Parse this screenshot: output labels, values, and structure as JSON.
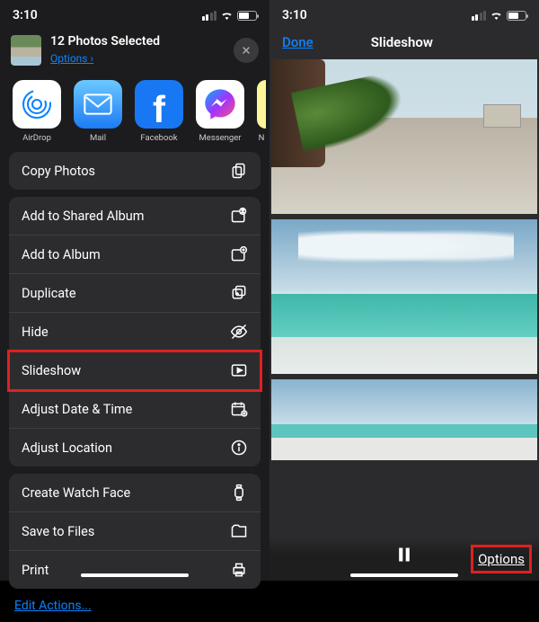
{
  "status": {
    "time": "3:10"
  },
  "left": {
    "header": {
      "title": "12 Photos Selected",
      "options_label": "Options ›"
    },
    "apps": [
      {
        "id": "airdrop",
        "label": "AirDrop"
      },
      {
        "id": "mail",
        "label": "Mail"
      },
      {
        "id": "facebook",
        "label": "Facebook"
      },
      {
        "id": "messenger",
        "label": "Messenger"
      },
      {
        "id": "notes-cut",
        "label": "N"
      }
    ],
    "groups": [
      [
        {
          "label": "Copy Photos",
          "icon": "copy-icon"
        }
      ],
      [
        {
          "label": "Add to Shared Album",
          "icon": "shared-album-icon"
        },
        {
          "label": "Add to Album",
          "icon": "album-add-icon"
        },
        {
          "label": "Duplicate",
          "icon": "duplicate-icon"
        },
        {
          "label": "Hide",
          "icon": "hide-icon"
        },
        {
          "label": "Slideshow",
          "icon": "play-rect-icon",
          "highlight": true
        },
        {
          "label": "Adjust Date & Time",
          "icon": "calendar-icon"
        },
        {
          "label": "Adjust Location",
          "icon": "info-icon"
        }
      ],
      [
        {
          "label": "Create Watch Face",
          "icon": "watch-icon"
        },
        {
          "label": "Save to Files",
          "icon": "folder-icon"
        },
        {
          "label": "Print",
          "icon": "print-icon"
        }
      ]
    ],
    "edit_actions": "Edit Actions..."
  },
  "right": {
    "done": "Done",
    "title": "Slideshow",
    "options_label": "Options"
  }
}
